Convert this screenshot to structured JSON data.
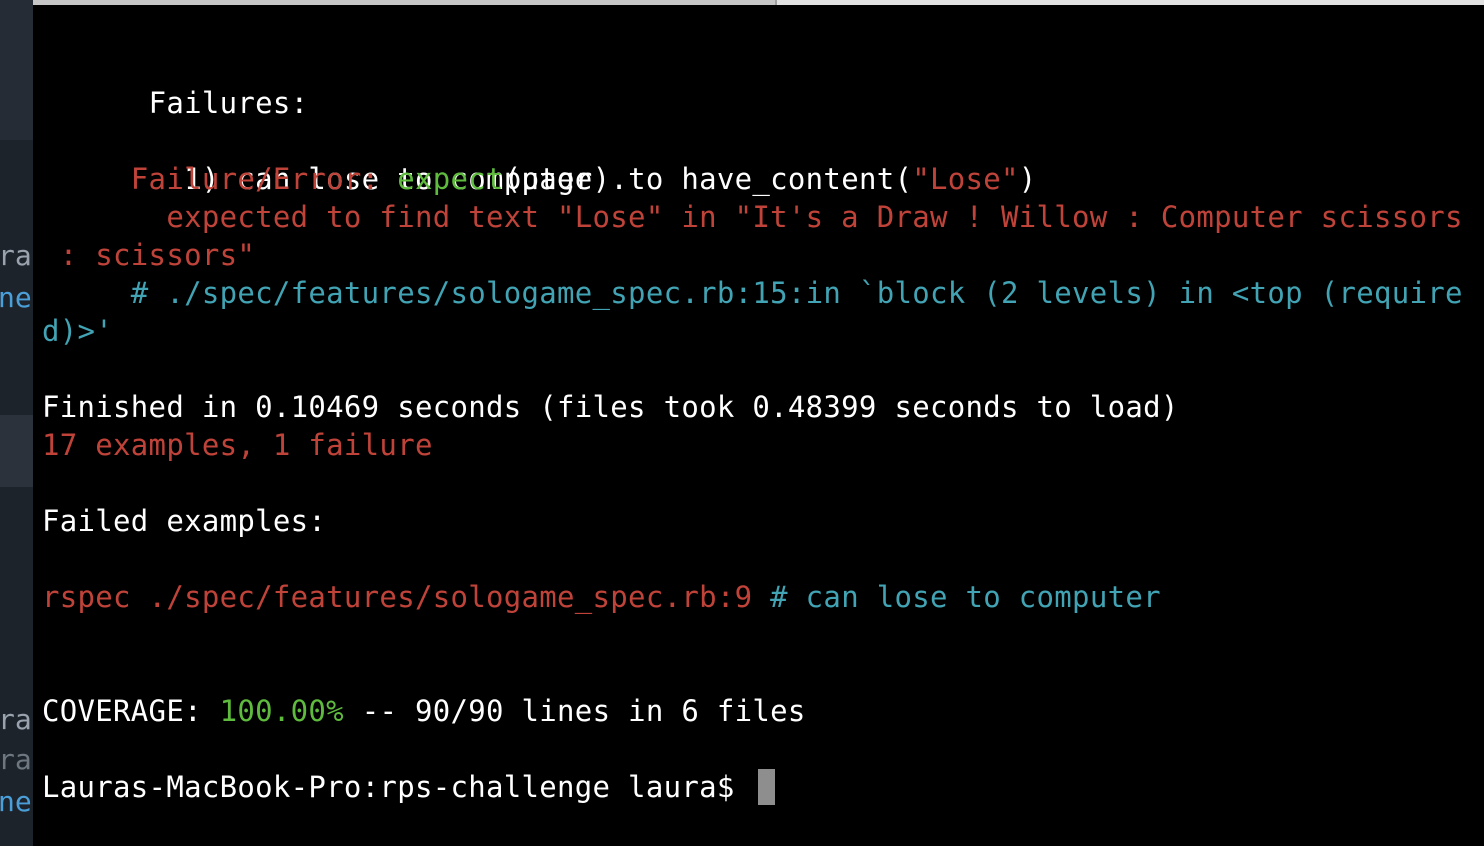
{
  "editor_fragments": {
    "frag1": "ra",
    "frag2": "ne",
    "frag3": "ra",
    "frag4": "ra",
    "frag5": "ne"
  },
  "terminal": {
    "failures_header": "Failures:",
    "failure_title": "  1) can lose to computer",
    "failure_error_label": "     Failure/Error: ",
    "failure_expect": "expect",
    "failure_code_mid": "(page).to have_content(",
    "failure_string": "\"Lose\"",
    "failure_code_end": ")",
    "expected_line1": "       expected to find text \"Lose\" in \"It's a Draw ! Willow : Computer scissors",
    "expected_line2": " : scissors\"",
    "trace_line1": "     # ./spec/features/sologame_spec.rb:15:in `block (2 levels) in <top (require",
    "trace_line2": "d)>'",
    "finished_line": "Finished in 0.10469 seconds (files took 0.48399 seconds to load)",
    "summary_line": "17 examples, 1 failure",
    "failed_examples_header": "Failed examples:",
    "rerun_command": "rspec ./spec/features/sologame_spec.rb:9",
    "rerun_comment": " # can lose to computer",
    "coverage_label": "COVERAGE: ",
    "coverage_percent": "100.00%",
    "coverage_rest": " -- 90/90 lines in 6 files",
    "prompt": "Lauras-MacBook-Pro:rps-challenge laura$ "
  },
  "colors": {
    "background": "#000000",
    "text": "#ffffff",
    "error_red": "#c0433a",
    "success_green": "#5ebb3e",
    "comment_cyan": "#41a3b3",
    "cursor": "#8e8e8e"
  }
}
